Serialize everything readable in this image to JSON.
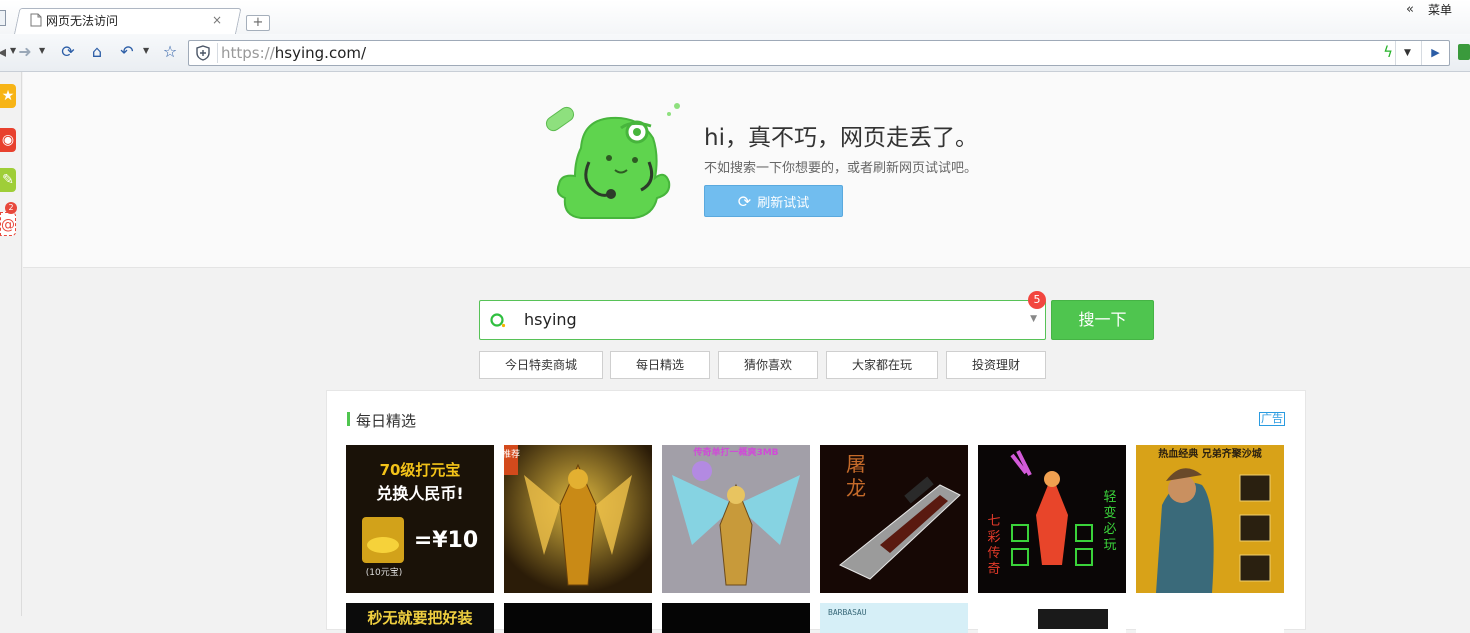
{
  "browser": {
    "tab_title": "网页无法访问",
    "new_tab_symbol": "+",
    "close_symbol": "×",
    "menu_chevron": "«",
    "menu_label": "菜单",
    "url_scheme": "https://",
    "url_host": "hsying.com/"
  },
  "error": {
    "title": "hi，真不巧，网页走丢了。",
    "subtitle": "不如搜索一下你想要的，或者刷新网页试试吧。",
    "refresh_label": "刷新试试"
  },
  "search": {
    "query": "hsying",
    "badge_count": "5",
    "button_label": "搜一下",
    "quick_links": [
      "今日特卖商城",
      "每日精选",
      "猜你喜欢",
      "大家都在玩",
      "投资理财"
    ]
  },
  "picks": {
    "title": "每日精选",
    "ad_label": "广告",
    "tiles": [
      {
        "lines": [
          "70级打元宝",
          "兑换人民币!",
          "=¥10",
          "(10元宝)"
        ],
        "bg": "#1a1208",
        "accent": "#f3c319"
      },
      {
        "lines": [
          "推荐"
        ],
        "bg": "#2b1c08",
        "accent": "#e0a423"
      },
      {
        "lines": [
          "传奇单打一概爽3MB"
        ],
        "bg": "#a29fa8",
        "accent": "#d04ad8"
      },
      {
        "lines": [
          "屠",
          "龙"
        ],
        "bg": "#160805",
        "accent": "#c46a2a"
      },
      {
        "lines": [
          "七",
          "彩",
          "传",
          "奇",
          "轻",
          "变",
          "必",
          "玩"
        ],
        "bg": "#0a0606",
        "accent": "#e23a2a"
      },
      {
        "lines": [
          "热血经典 兄弟齐聚沙城"
        ],
        "bg": "#d8a218",
        "accent": "#2a2010"
      }
    ],
    "second_row": [
      {
        "line": "秒无就要把好装",
        "bg": "#0b0b0b",
        "fg": "#f0d040"
      },
      {
        "line": "",
        "bg": "#050505",
        "fg": "#ffffff"
      },
      {
        "line": "",
        "bg": "#050505",
        "fg": "#ffffff"
      },
      {
        "line": "BARBASAU",
        "bg": "#d6eff7",
        "fg": "#3a6a7a"
      },
      {
        "line": "",
        "bg": "#ffffff",
        "fg": "#222"
      },
      {
        "line": "",
        "bg": "#ffffff",
        "fg": "#222"
      }
    ]
  },
  "colors": {
    "accent_green": "#4fc54f",
    "refresh_blue": "#71bdef",
    "badge_red": "#f2463f"
  }
}
